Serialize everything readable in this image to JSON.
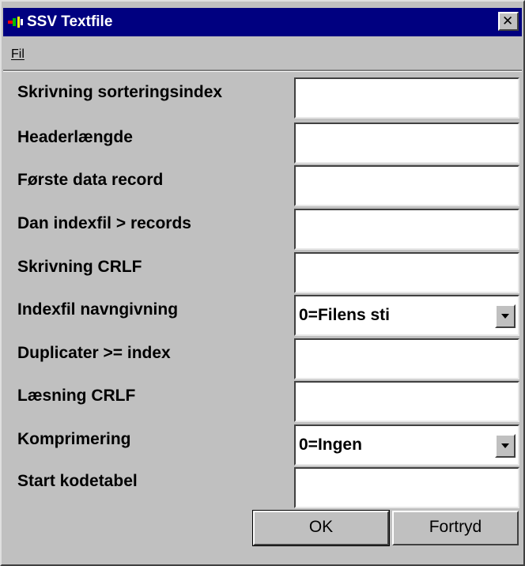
{
  "window": {
    "title": "SSV Textfile",
    "close_glyph": "✕"
  },
  "menu": {
    "items": [
      {
        "label": "Fil"
      }
    ]
  },
  "form": {
    "fields": [
      {
        "label": "Skrivning sorteringsindex",
        "value": ""
      },
      {
        "label": "Headerlængde",
        "value": ""
      },
      {
        "label": "Første data record",
        "value": ""
      },
      {
        "label": "Dan indexfil > records",
        "value": ""
      },
      {
        "label": "Skrivning CRLF",
        "value": ""
      },
      {
        "label": "Indexfil navngivning",
        "value": "0=Filens sti",
        "type": "select"
      },
      {
        "label": "Duplicater >= index",
        "value": ""
      },
      {
        "label": "Læsning CRLF",
        "value": ""
      },
      {
        "label": "Komprimering",
        "value": "0=Ingen",
        "type": "select"
      },
      {
        "label": "Start kodetabel",
        "value": ""
      }
    ]
  },
  "buttons": {
    "ok": {
      "label": "OK"
    },
    "cancel": {
      "label": "Fortryd"
    }
  },
  "colors": {
    "titlebar": "#000080",
    "face": "#c0c0c0",
    "field_bg": "#ffffff"
  },
  "icons": {
    "app": "app-icon",
    "close": "close-icon",
    "dropdown": "chevron-down-icon"
  }
}
